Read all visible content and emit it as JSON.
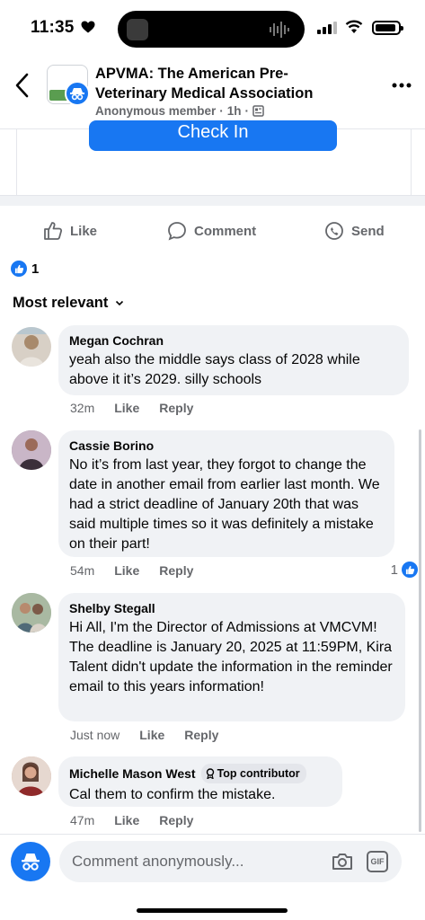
{
  "status": {
    "time": "11:35"
  },
  "header": {
    "title": "APVMA: The American Pre-Veterinary Medical Association",
    "author": "Anonymous member",
    "age": "1h"
  },
  "post": {
    "button_label": "Check In"
  },
  "actions": {
    "like": "Like",
    "comment": "Comment",
    "send": "Send"
  },
  "reactions": {
    "count": "1"
  },
  "sort": {
    "label": "Most relevant"
  },
  "comments": [
    {
      "name": "Megan Cochran",
      "text": "yeah also the middle says class of 2028 while above it it’s 2029. silly schools",
      "time": "32m",
      "like": "Like",
      "reply": "Reply"
    },
    {
      "name": "Cassie Borino",
      "text": "No it’s from last year, they forgot to change the date in another email from earlier last month. We had a strict deadline of January 20th that was said multiple times so it was definitely a mistake on their part!",
      "time": "54m",
      "like": "Like",
      "reply": "Reply",
      "likes": "1"
    },
    {
      "name": "Shelby Stegall",
      "text": "Hi All,  I'm the Director of Admissions at VMCVM! The deadline is January 20, 2025 at 11:59PM, Kira Talent didn't update the information in the reminder email to this years information!",
      "time": "Just now",
      "like": "Like",
      "reply": "Reply"
    },
    {
      "name": "Michelle Mason West",
      "badge": "Top contributor",
      "text": "Cal them to confirm the mistake.",
      "time": "47m",
      "like": "Like",
      "reply": "Reply"
    }
  ],
  "composer": {
    "placeholder": "Comment anonymously..."
  },
  "colors": {
    "accent": "#1877f2",
    "bubble": "#f0f2f5",
    "muted": "#65676b"
  }
}
